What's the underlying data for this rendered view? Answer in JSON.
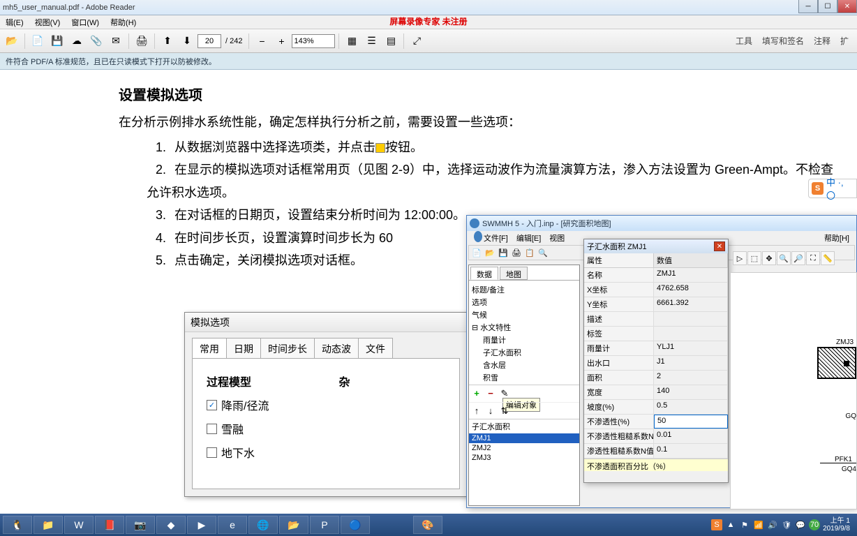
{
  "adobe": {
    "title": "mh5_user_manual.pdf - Adobe Reader",
    "menu": [
      "辑(E)",
      "视图(V)",
      "窗口(W)",
      "帮助(H)"
    ],
    "overlay": "屏幕录像专家 未注册",
    "page_current": "20",
    "page_total": "/ 242",
    "zoom": "143%",
    "right_tools": [
      "工具",
      "填写和签名",
      "注释",
      "扩"
    ],
    "info_bar": "件符合 PDF/A 标准规范，且已在只读模式下打开以防被修改。"
  },
  "pdf": {
    "heading": "设置模拟选项",
    "intro": "在分析示例排水系统性能，确定怎样执行分析之前，需要设置一些选项：",
    "items": [
      "从数据浏览器中选择选项类，并点击",
      "按钮。",
      "在显示的模拟选项对话框常用页（见图 2-9）中，选择运动波作为流量演算方法，渗入方法设置为 Green-Ampt。不检查允许积水选项。",
      "在对话框的日期页，设置结束分析时间为 12:00:00。",
      "在时间步长页，设置演算时间步长为 60",
      "点击确定，关闭模拟选项对话框。"
    ],
    "nums": [
      "1.",
      "2.",
      "3.",
      "4.",
      "5."
    ]
  },
  "sim_dialog": {
    "title": "模拟选项",
    "tabs": [
      "常用",
      "日期",
      "时间步长",
      "动态波",
      "文件"
    ],
    "section1": "过程模型",
    "section2": "杂",
    "check1": "降雨/径流",
    "check2": "雪融",
    "check3": "地下水"
  },
  "swmm": {
    "title": "SWMMH 5 - 入门.inp - [研究面积地图]",
    "menu": [
      "文件[F]",
      "编辑[E]",
      "视图",
      "",
      "",
      "",
      "帮助[H]"
    ],
    "browser_tabs": [
      "数据",
      "地图"
    ],
    "tree": [
      "标题/备注",
      "选项",
      "气候",
      "水文特性",
      "雨量计",
      "子汇水面积",
      "含水层",
      "积雪"
    ],
    "tooltip": "编辑对象",
    "list_label": "子汇水面积",
    "list_items": [
      "ZMJ1",
      "ZMJ2",
      "ZMJ3"
    ]
  },
  "props": {
    "title": "子汇水面积 ZMJ1",
    "header": [
      "属性",
      "数值"
    ],
    "rows": [
      [
        "名称",
        "ZMJ1"
      ],
      [
        "X坐标",
        "4762.658"
      ],
      [
        "Y坐标",
        "6661.392"
      ],
      [
        "描述",
        ""
      ],
      [
        "标签",
        ""
      ],
      [
        "雨量计",
        "YLJ1"
      ],
      [
        "出水口",
        "J1"
      ],
      [
        "面积",
        "2"
      ],
      [
        "宽度",
        "140"
      ],
      [
        "坡度(%)",
        "0.5"
      ],
      [
        "不渗透性(%)",
        "50"
      ],
      [
        "不渗透性粗糙系数N",
        "0.01"
      ],
      [
        "渗透性粗糙系数N值",
        "0.1"
      ]
    ],
    "status": "不渗透面积百分比（%）"
  },
  "map_labels": {
    "zmj3": "ZMJ3",
    "gq": "GQ",
    "pfk1": "PFK1",
    "gq4": "GQ4"
  },
  "ime": {
    "text": "中 ·, 〇"
  },
  "taskbar": {
    "time": "上午 1",
    "date": "2019/9/8",
    "battery": "70"
  }
}
